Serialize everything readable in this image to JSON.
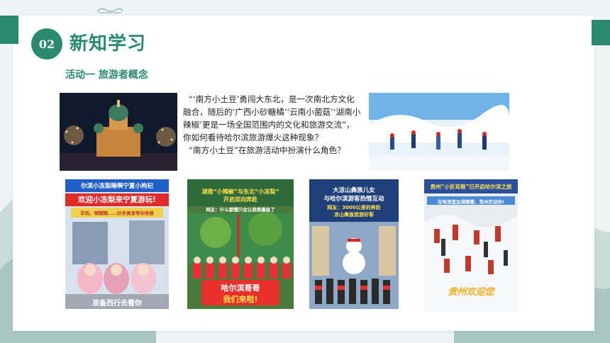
{
  "section": {
    "number": "02",
    "title": "新知学习"
  },
  "activity": {
    "title": "活动一  旅游者概念"
  },
  "text": {
    "paragraph1": "“‘南方小土豆’勇闯大东北，是一次南北方文化融合，随后的‘广西小砂糖橘’‘云南小菌菇’‘湖南小辣椒’更是一场全国范围内的文化和旅游交流”，你如何看待哈尔滨旅游爆火这种现象？",
    "paragraph2": "“南方小土豆”在旅游活动中扮演什么角色？"
  },
  "posters": [
    {
      "line1": "尔滨小冻梨睡啊宁夏小枸杞",
      "line2": "欢迎小冻梨来宁夏游玩!",
      "line3": "羊肉、辣糊糊……好多美食等你来尝",
      "bottom": "准备西行去看你"
    },
    {
      "line1": "湖南“小辣椒”与东北“小冻梨”",
      "line2": "开启双向奔赴",
      "line3": "网友：什么都懂只会让我羡慕极了",
      "bottom1": "哈尔滨哥哥",
      "bottom2": "我们来啦!"
    },
    {
      "line1": "大凉山彝族儿女",
      "line2": "与哈尔滨游客热情互动",
      "line3": "网友：3000公里的奔赴",
      "line4": "凉山彝族旅游好客"
    },
    {
      "line1": "贵州“小折耳根”已开启哈尔滨之旅",
      "line2": "在哈滨里加满暖暖，贵州欢迎你!",
      "bottom": "贵州欢迎您"
    }
  ]
}
